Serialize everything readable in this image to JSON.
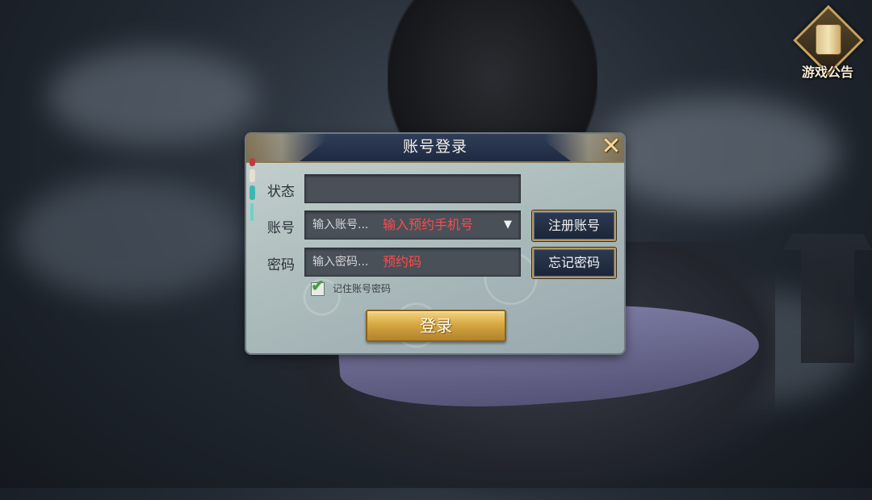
{
  "notice": {
    "label": "游戏公告"
  },
  "dialog": {
    "title": "账号登录",
    "close_symbol": "✕",
    "status": {
      "label": "状态",
      "value": ""
    },
    "account": {
      "label": "账号",
      "placeholder": "输入账号...",
      "hint": "输入预约手机号",
      "dropdown_symbol": "▼"
    },
    "password": {
      "label": "密码",
      "placeholder": "输入密码...",
      "hint": "预约码"
    },
    "register_label": "注册账号",
    "forgot_label": "忘记密码",
    "remember": {
      "label": "记住账号密码",
      "checked": true,
      "check_symbol": "✔"
    },
    "login_label": "登录"
  },
  "colors": {
    "hint_red": "#ff4a4a",
    "button_gold": "#d6a842",
    "header_navy": "#1e2a42"
  }
}
